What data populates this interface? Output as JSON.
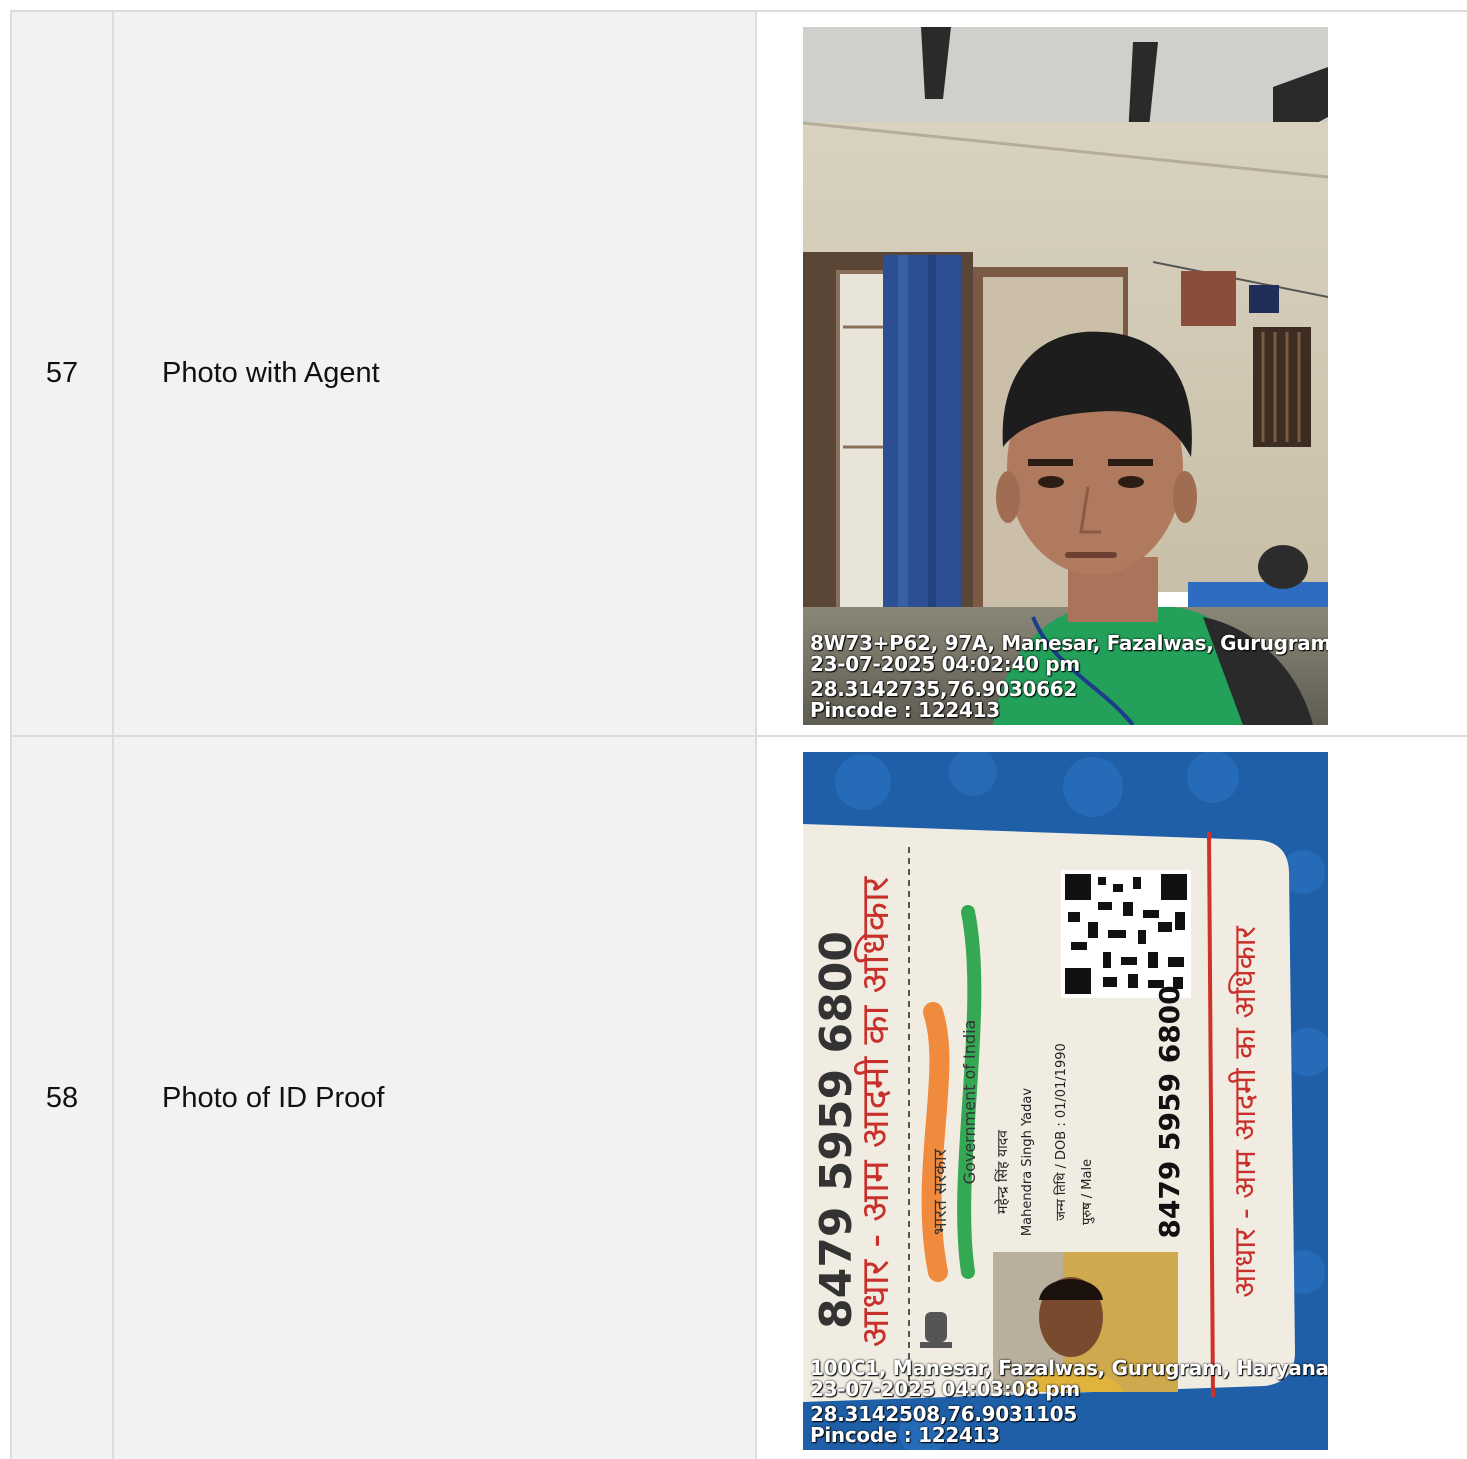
{
  "rows": [
    {
      "number": "57",
      "label": "Photo with Agent",
      "photo": {
        "icon": "selfie-photo",
        "stamp": {
          "address": "8W73+P62, 97A, Manesar, Fazalwas, Gurugram,",
          "datetime": "23-07-2025 04:02:40 pm",
          "coords": "28.3142735,76.9030662",
          "pincode": "Pincode : 122413"
        }
      }
    },
    {
      "number": "58",
      "label": "Photo of ID Proof",
      "photo": {
        "icon": "id-card-photo",
        "card": {
          "number_top": "8479 5959 6800",
          "number_main": "8479 5959 6800",
          "tagline_top": "आधार - आम आदमी का अधिकार",
          "tagline_bottom": "आधार - आम आदमी का अधिकार",
          "gov_hindi": "भारत सरकार",
          "gov_english": "Government of India",
          "name_hindi": "महेन्द्र सिंह यादव",
          "name_english": "Mahendra Singh Yadav",
          "dob": "जन्म तिथि / DOB : 01/01/1990",
          "gender": "पुरुष / Male"
        },
        "stamp": {
          "address": "100C1, Manesar, Fazalwas, Gurugram, Haryana",
          "datetime": "23-07-2025 04:03:08 pm",
          "coords": "28.3142508,76.9031105",
          "pincode": "Pincode : 122413"
        }
      }
    }
  ],
  "colors": {
    "cell_bg": "#f2f2f2",
    "border": "#dcdcdc",
    "card_blue": "#1e5fa8",
    "shirt_green": "#23a05a"
  }
}
